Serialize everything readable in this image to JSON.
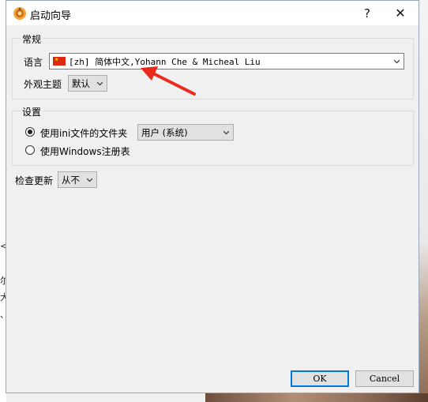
{
  "window": {
    "title": "启动向导",
    "help": "?",
    "close": "✕"
  },
  "general": {
    "group_title": "常规",
    "language_label": "语言",
    "language_value": "[zh] 简体中文,Yohann Che & Micheal Liu",
    "theme_label": "外观主题",
    "theme_value": "默认"
  },
  "settings": {
    "group_title": "设置",
    "option_ini": "使用ini文件的文件夹",
    "option_ini_folder": "用户 (系统)",
    "option_registry": "使用Windows注册表"
  },
  "update": {
    "label": "检查更新",
    "value": "从不"
  },
  "buttons": {
    "ok": "OK",
    "cancel": "Cancel"
  },
  "colors": {
    "arrow": "#e8291c",
    "accent": "#0078d7"
  }
}
